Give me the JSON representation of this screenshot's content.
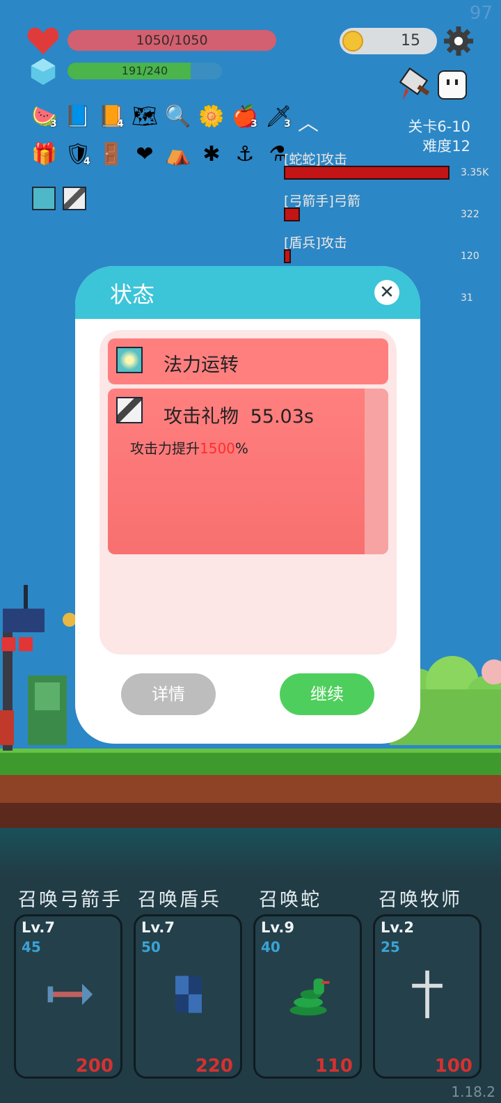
{
  "hud": {
    "fps": "97",
    "hp_text": "1050/1050",
    "mp_text": "191/240",
    "mp_fraction": 0.7958,
    "coins": "15",
    "stage": "关卡6-10",
    "difficulty": "难度12",
    "version": "1.18.2"
  },
  "items_row1": [
    {
      "icon": "watermelon-icon",
      "count": "3"
    },
    {
      "icon": "bible-icon",
      "count": ""
    },
    {
      "icon": "book-icon",
      "count": "4"
    },
    {
      "icon": "treasure-map-icon",
      "count": ""
    },
    {
      "icon": "magnifier-icon",
      "count": ""
    },
    {
      "icon": "flower-icon",
      "count": ""
    },
    {
      "icon": "apple-icon",
      "count": "3"
    },
    {
      "icon": "sword-icon",
      "count": "3"
    }
  ],
  "items_row2": [
    {
      "icon": "gift-icon",
      "count": ""
    },
    {
      "icon": "shield-icon",
      "count": "4"
    },
    {
      "icon": "door-icon",
      "count": ""
    },
    {
      "icon": "heart-icon",
      "count": ""
    },
    {
      "icon": "tent-icon",
      "count": ""
    },
    {
      "icon": "mace-icon",
      "count": ""
    },
    {
      "icon": "hook-icon",
      "count": ""
    },
    {
      "icon": "potion-icon",
      "count": ""
    }
  ],
  "damage_stats": [
    {
      "label": "[蛇蛇]攻击",
      "value": "3.35K",
      "fraction": 1.0
    },
    {
      "label": "[弓箭手]弓箭",
      "value": "322",
      "fraction": 0.096
    },
    {
      "label": "[盾兵]攻击",
      "value": "120",
      "fraction": 0.036
    },
    {
      "label": "",
      "value": "31",
      "fraction": 0.0
    }
  ],
  "dialog": {
    "title": "状态",
    "close_symbol": "✕",
    "statuses": [
      {
        "name": "法力运转",
        "timer": ""
      },
      {
        "name": "攻击礼物",
        "timer": "55.03s",
        "desc_prefix": "攻击力提升",
        "desc_value": "1500",
        "desc_suffix": "%"
      }
    ],
    "detail_label": "详情",
    "continue_label": "继续"
  },
  "summons": [
    {
      "label": "召唤弓箭手",
      "level": "Lv.7",
      "cost": "45",
      "price": "200",
      "icon": "arrow-icon"
    },
    {
      "label": "召唤盾兵",
      "level": "Lv.7",
      "cost": "50",
      "price": "220",
      "icon": "shield-icon"
    },
    {
      "label": "召唤蛇",
      "level": "Lv.9",
      "cost": "40",
      "price": "110",
      "icon": "snake-icon"
    },
    {
      "label": "召唤牧师",
      "level": "Lv.2",
      "cost": "25",
      "price": "100",
      "icon": "cross-icon"
    }
  ],
  "colors": {
    "sky": "#2c87c6",
    "hp_bar": "#d26070",
    "mp_bar": "#4bb44a",
    "dialog_header": "#3cc4d8",
    "status_row": "#ff7f7f",
    "continue_button": "#4ecf5d",
    "detail_button": "#bdbdbd"
  }
}
